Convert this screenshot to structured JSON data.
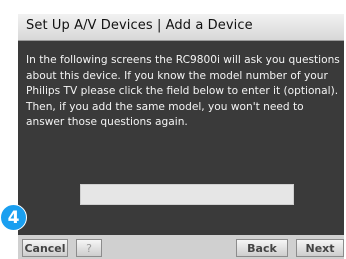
{
  "title": "Set Up A/V Devices | Add a Device",
  "instructions": "In the following screens the RC9800i will ask you questions about this device. If you know the model number of your Philips TV please click the field below to enter it (optional). Then, if you add the same model, you won't need to answer those questions again.",
  "model_field": {
    "value": ""
  },
  "step_badge": "4",
  "buttons": {
    "cancel": "Cancel",
    "help": "?",
    "back": "Back",
    "next": "Next"
  },
  "colors": {
    "panel": "#3a3a3a",
    "badge": "#1a9ff0",
    "title_bar": "#e2e2e2",
    "bottom_bar": "#d0d0d0"
  }
}
